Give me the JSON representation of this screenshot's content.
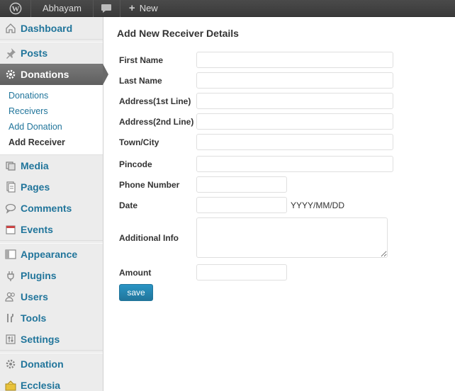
{
  "adminbar": {
    "site_name": "Abhayam",
    "new_label": "New"
  },
  "sidebar": {
    "items": [
      {
        "label": "Dashboard",
        "icon": "home-icon"
      },
      {
        "label": "Posts",
        "icon": "pin-icon"
      },
      {
        "label": "Donations",
        "icon": "gear-icon",
        "current": true
      },
      {
        "label": "Media",
        "icon": "media-icon"
      },
      {
        "label": "Pages",
        "icon": "pages-icon"
      },
      {
        "label": "Comments",
        "icon": "comment-icon"
      },
      {
        "label": "Events",
        "icon": "calendar-icon"
      },
      {
        "label": "Appearance",
        "icon": "appearance-icon"
      },
      {
        "label": "Plugins",
        "icon": "plug-icon"
      },
      {
        "label": "Users",
        "icon": "users-icon"
      },
      {
        "label": "Tools",
        "icon": "tools-icon"
      },
      {
        "label": "Settings",
        "icon": "settings-icon"
      },
      {
        "label": "Donation",
        "icon": "gear-icon"
      },
      {
        "label": "Ecclesia",
        "icon": "church-icon"
      }
    ],
    "submenu": [
      "Donations",
      "Receivers",
      "Add Donation",
      "Add Receiver"
    ]
  },
  "form": {
    "title": "Add New Receiver Details",
    "labels": {
      "first_name": "First Name",
      "last_name": "Last Name",
      "address1": "Address(1st Line)",
      "address2": "Address(2nd Line)",
      "town": "Town/City",
      "pincode": "Pincode",
      "phone": "Phone Number",
      "date": "Date",
      "additional": "Additional Info",
      "amount": "Amount"
    },
    "date_hint": "YYYY/MM/DD",
    "save_label": "save"
  },
  "colors": {
    "link": "#21759b",
    "adminbar": "#464646",
    "current_menu": "#6a6a6a",
    "button": "#21759b"
  }
}
